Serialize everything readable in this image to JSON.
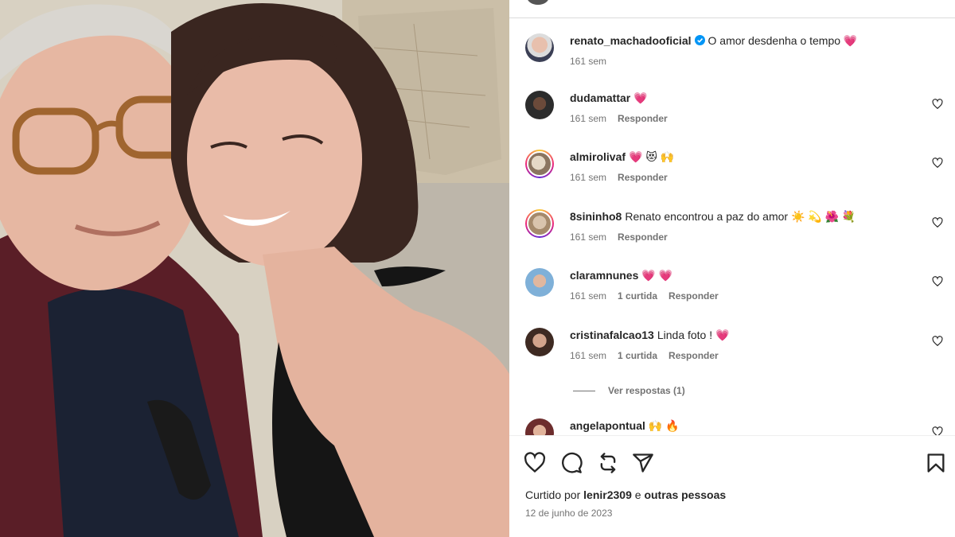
{
  "post": {
    "author": "renato_machadooficial",
    "caption": "O amor desdenha o tempo 💗",
    "caption_time": "161 sem"
  },
  "comments": [
    {
      "user": "dudamattar",
      "text": "💗",
      "time": "161 sem",
      "likes": "",
      "reply": "Responder"
    },
    {
      "user": "almirolivaf",
      "text": "💗 😻 🙌",
      "time": "161 sem",
      "likes": "",
      "reply": "Responder"
    },
    {
      "user": "8sininho8",
      "text": "Renato encontrou a paz do amor ☀️ 💫 🌺 💐",
      "time": "161 sem",
      "likes": "",
      "reply": "Responder"
    },
    {
      "user": "claramnunes",
      "text": "💗 💗",
      "time": "161 sem",
      "likes": "1 curtida",
      "reply": "Responder"
    },
    {
      "user": "cristinafalcao13",
      "text": "Linda foto ! 💗",
      "time": "161 sem",
      "likes": "1 curtida",
      "reply": "Responder"
    },
    {
      "user": "angelapontual",
      "text": "🙌 🔥",
      "time": "",
      "likes": "",
      "reply": ""
    }
  ],
  "view_replies": "Ver respostas (1)",
  "liked_by": {
    "prefix": "Curtido por",
    "user": "lenir2309",
    "joiner": "e",
    "others": "outras pessoas"
  },
  "date": "12 de junho de 2023",
  "icons": [
    "heart-icon",
    "comment-icon",
    "repost-icon",
    "share-icon",
    "bookmark-icon",
    "verified-badge-icon"
  ],
  "colors": {
    "verified": "#0095f6",
    "meta_text": "#737373"
  }
}
